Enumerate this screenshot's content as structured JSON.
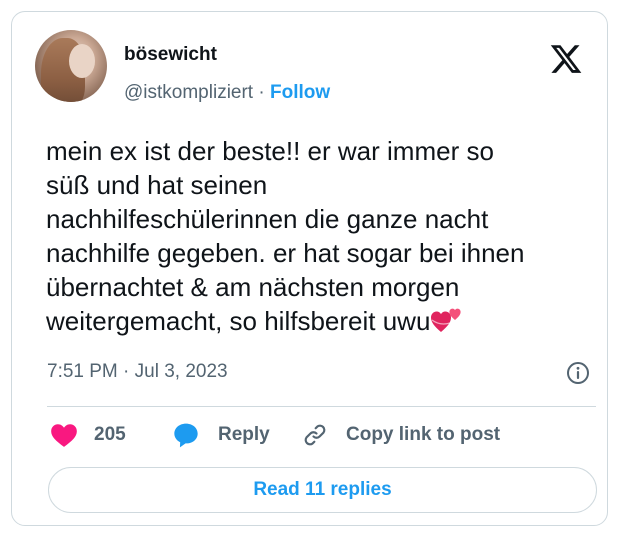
{
  "author": {
    "display_name": "bösewicht",
    "handle": "@istkompliziert",
    "separator": "·",
    "follow_label": "Follow"
  },
  "tweet": {
    "text": "mein ex ist der beste!! er war immer so\nsüß und hat seinen\nnachhilfeschülerinnen die ganze nacht\nnachhilfe gegeben. er hat sogar bei ihnen\nübernachtet & am nächsten morgen\nweitergemacht, so hilfsbereit uwu",
    "emoji": "two-hearts",
    "time": "7:51 PM",
    "separator": "·",
    "date": "Jul 3, 2023"
  },
  "actions": {
    "like_count": "205",
    "reply_label": "Reply",
    "copy_label": "Copy link to post"
  },
  "footer": {
    "read_replies_label": "Read 11 replies"
  },
  "icons": {
    "logo": "x-logo-icon",
    "info": "info-icon",
    "like": "heart-icon",
    "reply": "speech-bubble-icon",
    "copy": "link-icon"
  },
  "colors": {
    "accent": "#1d9bf0",
    "like": "#f91880",
    "muted": "#536471",
    "text": "#0f1419",
    "border": "#cfd9de"
  }
}
